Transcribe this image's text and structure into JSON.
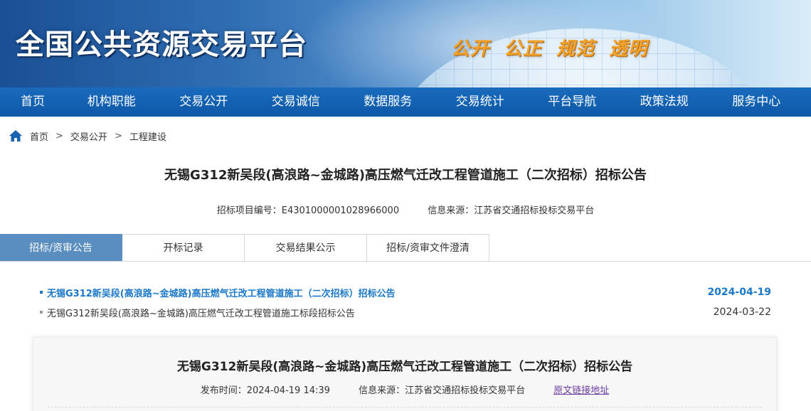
{
  "header": {
    "site_title": "全国公共资源交易平台",
    "slogan": "公开 公正 规范 透明"
  },
  "nav": {
    "items": [
      "首页",
      "机构职能",
      "交易公开",
      "交易诚信",
      "数据服务",
      "交易统计",
      "平台导航",
      "政策法规",
      "服务中心"
    ]
  },
  "breadcrumb": {
    "items": [
      "首页",
      "交易公开",
      "工程建设"
    ],
    "separator": ">"
  },
  "page": {
    "title": "无锡G312新吴段(高浪路~金城路)高压燃气迁改工程管道施工（二次招标）招标公告",
    "project_no": "招标项目编号：E4301000001028966000",
    "source": "信息来源：江苏省交通招标投标交易平台"
  },
  "tabs": [
    "招标/资审公告",
    "开标记录",
    "交易结果公示",
    "招标/资审文件澄清"
  ],
  "announcements": [
    {
      "title": "无锡G312新吴段(高浪路~金城路)高压燃气迁改工程管道施工（二次招标）招标公告",
      "date": "2024-04-19"
    },
    {
      "title": "无锡G312新吴段(高浪路~金城路)高压燃气迁改工程管道施工标段招标公告",
      "date": "2024-03-22"
    }
  ],
  "article": {
    "title": "无锡G312新吴段(高浪路~金城路)高压燃气迁改工程管道施工（二次招标）招标公告",
    "publish_time": "发布时间：2024-04-19 14:39",
    "source": "信息来源：江苏省交通招标投标交易平台",
    "link_text": "原文链接地址"
  },
  "colors": {
    "nav_bg": "#0d58a6",
    "active_tab": "#5b8ec0",
    "link_blue": "#1b78c8",
    "slogan_orange": "#f2a12b"
  }
}
